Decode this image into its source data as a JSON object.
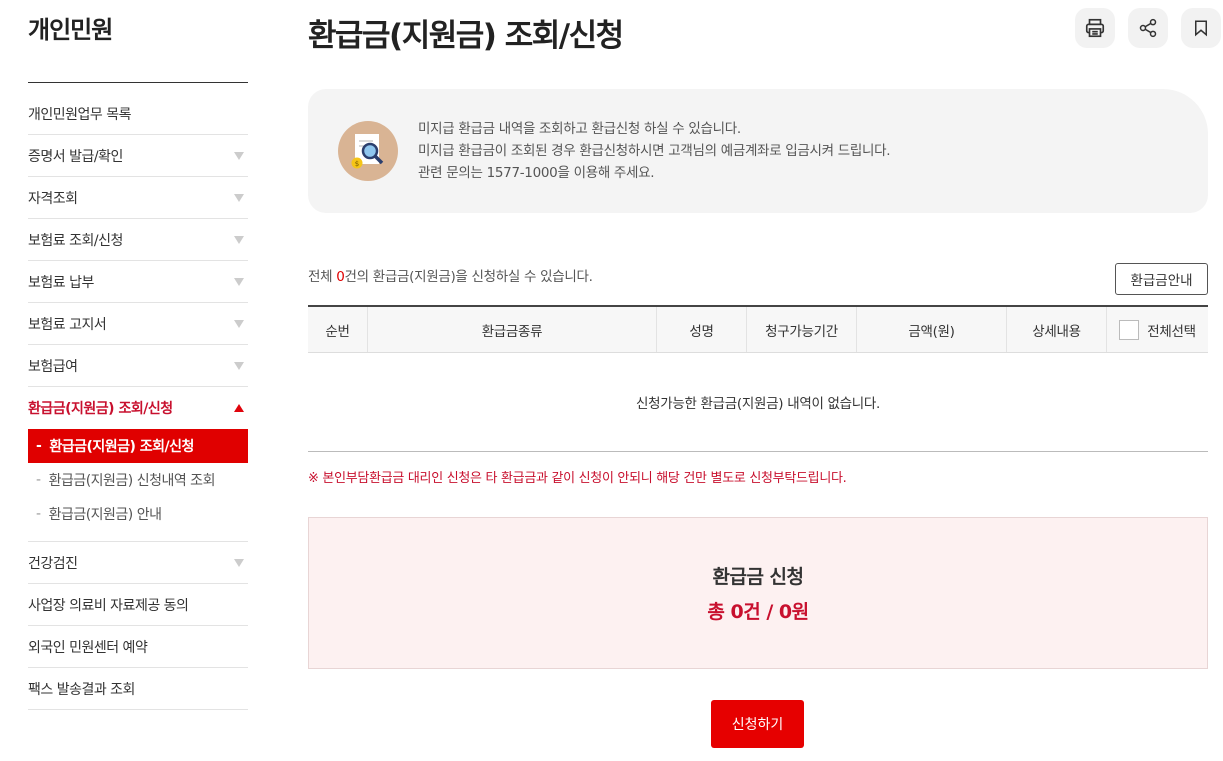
{
  "sidebar": {
    "title": "개인민원",
    "items": [
      {
        "label": "개인민원업무 목록"
      },
      {
        "label": "증명서 발급/확인"
      },
      {
        "label": "자격조회"
      },
      {
        "label": "보험료 조회/신청"
      },
      {
        "label": "보험료 납부"
      },
      {
        "label": "보험료 고지서"
      },
      {
        "label": "보험급여"
      },
      {
        "label": "환급금(지원금) 조회/신청"
      },
      {
        "label": "건강검진"
      },
      {
        "label": "사업장 의료비 자료제공 동의"
      },
      {
        "label": "외국인 민원센터 예약"
      },
      {
        "label": "팩스 발송결과 조회"
      }
    ],
    "subitems": [
      {
        "dash": "-",
        "label": "환급금(지원금) 조회/신청"
      },
      {
        "dash": "-",
        "label": "환급금(지원금) 신청내역 조회"
      },
      {
        "dash": "-",
        "label": "환급금(지원금) 안내"
      }
    ]
  },
  "page": {
    "title": "환급금(지원금) 조회/신청"
  },
  "tools": {
    "print_icon": "printer-icon",
    "share_icon": "share-icon",
    "bookmark_icon": "bookmark-icon"
  },
  "info": {
    "lines": [
      "미지급 환급금 내역을 조회하고 환급신청 하실 수 있습니다.",
      "미지급 환급금이 조회된 경우 환급신청하시면 고객님의 예금계좌로 입금시켜 드립니다.",
      "관련 문의는 1577-1000을 이용해 주세요."
    ]
  },
  "summary": {
    "prefix": "전체 ",
    "count": "0",
    "suffix": "건의 환급금(지원금)을 신청하실 수 있습니다."
  },
  "guide_button": "환급금안내",
  "table": {
    "headers": [
      "순번",
      "환급금종류",
      "성명",
      "청구가능기간",
      "금액(원)",
      "상세내용",
      "전체선택"
    ],
    "empty_message": "신청가능한 환급금(지원금) 내역이 없습니다."
  },
  "notice": "※ 본인부담환급금 대리인 신청은 타 환급금과 같이 신청이 안되니 해당 건만 별도로 신청부탁드립니다.",
  "apply": {
    "title": "환급금 신청",
    "total": "총 0건 / 0원",
    "button": "신청하기"
  },
  "colors": {
    "accent": "#e60000",
    "active_text": "#c8102e",
    "info_bg": "#f4f4f4",
    "apply_bg": "#fdf1f1"
  }
}
